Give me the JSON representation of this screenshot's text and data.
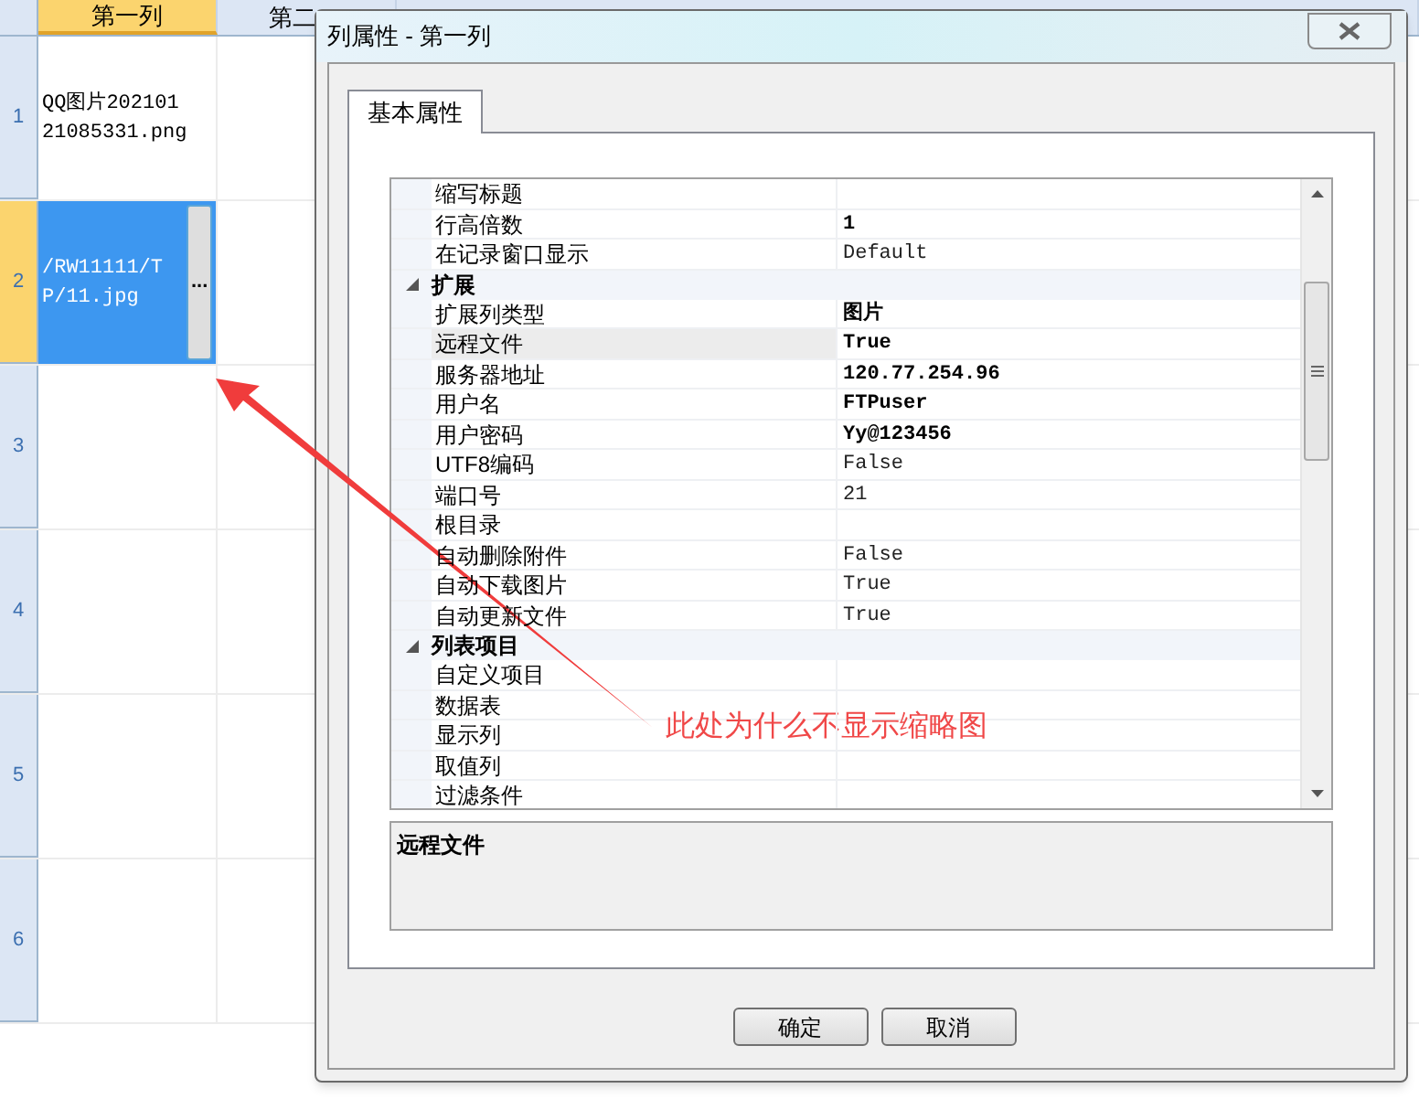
{
  "sheet": {
    "columns": [
      {
        "label": "第一列",
        "selected": true
      },
      {
        "label": "第二",
        "selected": false
      }
    ],
    "rows": [
      {
        "number": "1",
        "selected": false,
        "cell": "QQ图片20210121085331.png"
      },
      {
        "number": "2",
        "selected": true,
        "cell": "/RW11111/TP/11.jpg",
        "button": "..."
      },
      {
        "number": "3",
        "selected": false
      },
      {
        "number": "4",
        "selected": false
      },
      {
        "number": "5",
        "selected": false
      },
      {
        "number": "6",
        "selected": false
      }
    ]
  },
  "dialog": {
    "title": "列属性 - 第一列",
    "tabs": [
      {
        "label": "基本属性",
        "selected": true
      }
    ],
    "properties": [
      {
        "kind": "item",
        "name": "缩写标题",
        "selected": false
      },
      {
        "kind": "item",
        "name": "行高倍数",
        "value": "1",
        "modified": true,
        "selected": false
      },
      {
        "kind": "item",
        "name": "在记录窗口显示",
        "value": "Default",
        "modified": false,
        "selected": false
      },
      {
        "kind": "category",
        "name": "扩展",
        "expanded": true
      },
      {
        "kind": "item",
        "name": "扩展列类型",
        "value": "图片",
        "modified": true,
        "selected": false
      },
      {
        "kind": "item",
        "name": "远程文件",
        "value": "True",
        "modified": true,
        "selected": true
      },
      {
        "kind": "item",
        "name": "服务器地址",
        "value": "120.77.254.96",
        "modified": true,
        "selected": false
      },
      {
        "kind": "item",
        "name": "用户名",
        "value": "FTPuser",
        "modified": true,
        "selected": false
      },
      {
        "kind": "item",
        "name": "用户密码",
        "value": "Yy@123456",
        "modified": true,
        "selected": false
      },
      {
        "kind": "item",
        "name": "UTF8编码",
        "value": "False",
        "modified": false,
        "selected": false
      },
      {
        "kind": "item",
        "name": "端口号",
        "value": "21",
        "modified": false,
        "selected": false
      },
      {
        "kind": "item",
        "name": "根目录",
        "selected": false
      },
      {
        "kind": "item",
        "name": "自动删除附件",
        "value": "False",
        "modified": false,
        "selected": false
      },
      {
        "kind": "item",
        "name": "自动下载图片",
        "value": "True",
        "modified": false,
        "selected": false
      },
      {
        "kind": "item",
        "name": "自动更新文件",
        "value": "True",
        "modified": false,
        "selected": false
      },
      {
        "kind": "category",
        "name": "列表项目",
        "expanded": true
      },
      {
        "kind": "item",
        "name": "自定义项目",
        "selected": false
      },
      {
        "kind": "item",
        "name": "数据表",
        "selected": false
      },
      {
        "kind": "item",
        "name": "显示列",
        "selected": false
      },
      {
        "kind": "item",
        "name": "取值列",
        "selected": false
      },
      {
        "kind": "item",
        "name": "过滤条件",
        "selected": false
      }
    ],
    "description": "远程文件",
    "buttons": [
      "确定",
      "取消"
    ]
  },
  "annotation": {
    "text": "此处为什么不显示缩略图"
  }
}
